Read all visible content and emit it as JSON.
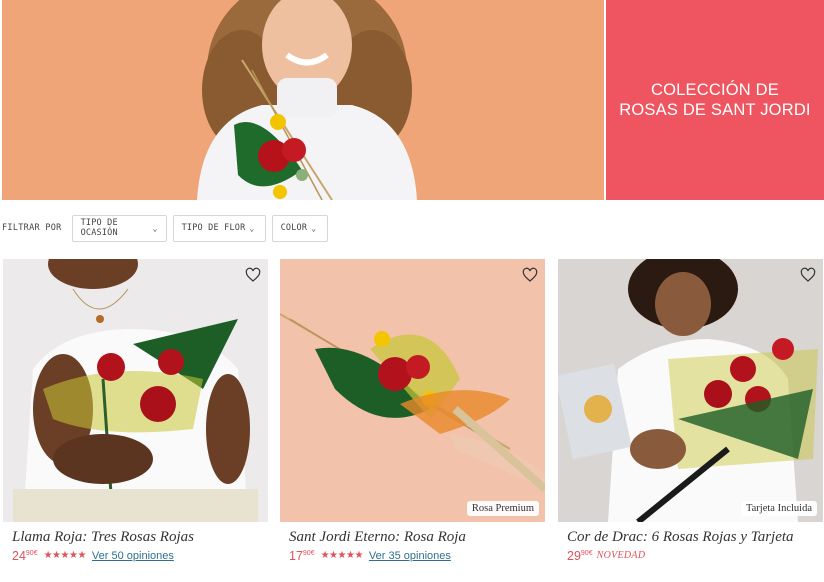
{
  "hero": {
    "title_line1": "COLECCIÓN DE",
    "title_line2": "ROSAS DE SANT JORDI",
    "card_color": "#ef5560",
    "photo_bg": "#efa577"
  },
  "filters": {
    "label": "FILTRAR POR",
    "buttons": [
      "TIPO DE OCASIÓN",
      "TIPO DE FLOR",
      "COLOR"
    ]
  },
  "products": [
    {
      "name": "Llama Roja: Tres Rosas Rojas",
      "price_int": "24",
      "price_dec": "90€",
      "rating": 4.5,
      "reviews": "Ver 50 opiniones",
      "badge": ""
    },
    {
      "name": "Sant Jordi Eterno: Rosa Roja",
      "price_int": "17",
      "price_dec": "90€",
      "rating": 4.5,
      "reviews": "Ver 35 opiniones",
      "badge": "Rosa Premium"
    },
    {
      "name": "Cor de Drac: 6 Rosas Rojas y Tarjeta",
      "price_int": "29",
      "price_dec": "90€",
      "tag": "NOVEDAD",
      "badge": "Tarjeta Incluida"
    }
  ],
  "colors": {
    "accent": "#e0525c",
    "link": "#2f6f8f"
  },
  "icons": {
    "favorite": "heart-outline-icon",
    "dropdown": "chevron-down-icon",
    "rating": "star-icon"
  }
}
